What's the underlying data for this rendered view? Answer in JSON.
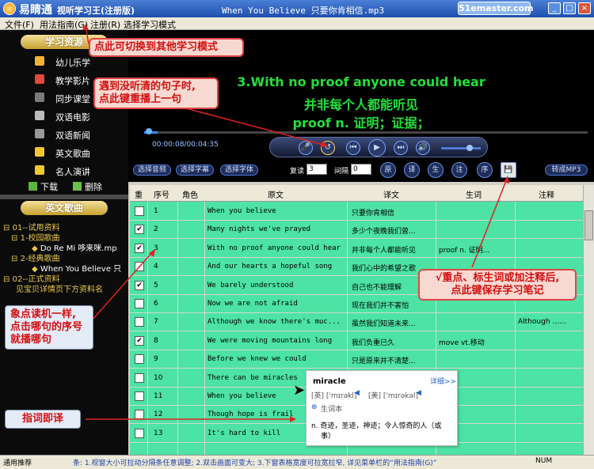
{
  "titlebar": {
    "app_name": "易睛通",
    "app_subtitle": "视听学习王(注册版)",
    "file_title": "When You Believe 只要你肯相信.mp3",
    "watermark": "51emaster.com"
  },
  "menu": [
    "文件(F)",
    "用法指南(G)",
    "注册(R)",
    "选择学习模式"
  ],
  "sidebar": {
    "section1": "学习资源",
    "items": [
      "幼儿乐学",
      "教学影片",
      "同步课堂",
      "双语电影",
      "双语新闻",
      "英文歌曲",
      "名人演讲"
    ],
    "download": "下载",
    "delete": "删除",
    "section2": "英文歌曲",
    "tree": [
      {
        "prefix": "⊟",
        "label": "01--试用资料"
      },
      {
        "prefix": "⊟",
        "label": "1-校园歌曲"
      },
      {
        "prefix": "◆",
        "label": "Do Re Mi 哆来咪.mp"
      },
      {
        "prefix": "⊟",
        "label": "2-经典歌曲"
      },
      {
        "prefix": "◆",
        "label": "When You Believe 只"
      },
      {
        "prefix": "⊟",
        "label": "02--正式资料"
      },
      {
        "prefix": "",
        "label": "见宝贝详情页下方资料名"
      }
    ]
  },
  "player": {
    "lyric_en": "3.With no proof anyone could hear",
    "lyric_cn": "并非每个人都能听见",
    "lyric_note": "proof n. 证明；证据；",
    "time": "00:00:08/00:04:35",
    "progress": 0.03,
    "volume": 0.65,
    "buttons": {
      "audio": "选择音频",
      "subtitle": "选择字幕",
      "font": "选择字体"
    },
    "repeat_label": "复读",
    "repeat_value": "3",
    "interval_label": "间隔",
    "interval_value": "0",
    "mode_btns": [
      "原",
      "译",
      "生",
      "注",
      "序"
    ],
    "convert": "转成MP3"
  },
  "table": {
    "headers": [
      "重",
      "序号",
      "角色",
      "原文",
      "译文",
      "生词",
      "注释"
    ],
    "rows": [
      {
        "checked": false,
        "num": "1",
        "orig": "When you believe",
        "trans": "只要你肯相信",
        "vocab": "",
        "note": ""
      },
      {
        "checked": true,
        "num": "2",
        "orig": "Many nights we've prayed",
        "trans": "多少个夜晚我们曾...",
        "vocab": "",
        "note": ""
      },
      {
        "checked": true,
        "num": "3",
        "orig": "With no proof anyone could hear",
        "trans": "并非每个人都能听见",
        "vocab": "proof n. 证明...",
        "note": ""
      },
      {
        "checked": false,
        "num": "4",
        "orig": "And our hearts a hopeful song",
        "trans": "我们心中的希望之歌",
        "vocab": "",
        "note": ""
      },
      {
        "checked": true,
        "num": "5",
        "orig": "We barely understood",
        "trans": "自己也不能理解",
        "vocab": "",
        "note": ""
      },
      {
        "checked": false,
        "num": "6",
        "orig": "Now we are not afraid",
        "trans": "现在我们并不害怕",
        "vocab": "",
        "note": ""
      },
      {
        "checked": false,
        "num": "7",
        "orig": "Although we know there's muc...",
        "trans": "虽然我们知道未来...",
        "vocab": "",
        "note": "Although ……"
      },
      {
        "checked": true,
        "num": "8",
        "orig": "We were moving mountains long",
        "trans": "我们负重已久",
        "vocab": "move vt.移动",
        "note": ""
      },
      {
        "checked": false,
        "num": "9",
        "orig": "Before we knew we could",
        "trans": "只是原来并不清楚...",
        "vocab": "",
        "note": ""
      },
      {
        "checked": false,
        "num": "10",
        "orig": "There can be miracles",
        "trans": "",
        "vocab": "",
        "note": ""
      },
      {
        "checked": false,
        "num": "11",
        "orig": "When you believe",
        "trans": "",
        "vocab": "",
        "note": ""
      },
      {
        "checked": false,
        "num": "12",
        "orig": "Though hope is frail",
        "trans": "",
        "vocab": "",
        "note": ""
      },
      {
        "checked": false,
        "num": "13",
        "orig": "It's hard to kill",
        "trans": "",
        "vocab": "",
        "note": ""
      }
    ]
  },
  "dictionary": {
    "word": "miracle",
    "more": "详细>>",
    "phon_uk": "[英] ['mɪrəkl]",
    "phon_us": "[美] ['mɪrəkəl]",
    "add": "生词本",
    "def_line1": "n. 奇迹，圣迹，神迹；令人惊奇的人（或",
    "def_line2": "事）"
  },
  "callouts": {
    "switch_mode": "点此可切换到其他学习模式",
    "replay_l1": "遇到没听清的句子时,",
    "replay_l2": "点此键重播上一句",
    "save_l1": "√重点、标生词或加注释后,",
    "save_l2": "点此键保存学习笔记",
    "click_l1": "象点读机一样,",
    "click_l2": "点击哪句的序号",
    "click_l3": "就播哪句",
    "translate": "指词即译"
  },
  "statusbar": {
    "left": "通用推荐",
    "hint": "条: 1.视窗大小可拉动分隔条任意调整; 2.双击画面可变大; 3.下窗表格宽度可拉宽拉窄, 详见菜单栏的“用法指南(G)”",
    "num": "NUM"
  }
}
